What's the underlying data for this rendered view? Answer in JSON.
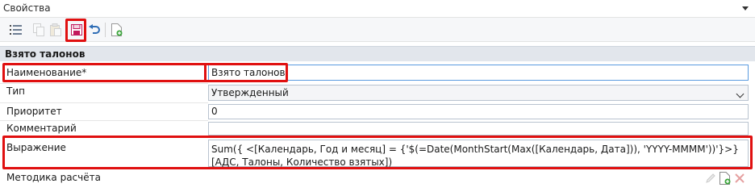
{
  "panel": {
    "title": "Свойства"
  },
  "toolbar": {
    "buttons": [
      {
        "name": "list-view",
        "icon": "list-icon",
        "enabled": true
      },
      {
        "name": "copy",
        "icon": "copy-icon",
        "enabled": false
      },
      {
        "name": "paste",
        "icon": "paste-icon",
        "enabled": false
      },
      {
        "name": "save",
        "icon": "save-icon",
        "enabled": true
      },
      {
        "name": "undo",
        "icon": "undo-icon",
        "enabled": true
      },
      {
        "name": "new-document",
        "icon": "new-document-icon",
        "enabled": true
      }
    ]
  },
  "section": {
    "title": "Взято талонов"
  },
  "fields": {
    "name": {
      "label": "Наименование*",
      "value": "Взято талонов"
    },
    "type": {
      "label": "Тип",
      "value": "Утвержденный"
    },
    "priority": {
      "label": "Приоритет",
      "value": "0"
    },
    "comment": {
      "label": "Комментарий",
      "value": ""
    },
    "expression": {
      "label": "Выражение",
      "value": "Sum({ <[Календарь, Год и месяц] = {'$(=Date(MonthStart(Max([Календарь, Дата])), 'YYYY-MMMM'))'}>} [АДС, Талоны, Количество взятых])"
    },
    "method": {
      "label": "Методика расчёта"
    }
  },
  "colors": {
    "highlight": "#e01010",
    "section_bg": "#e2e6ec",
    "field_border": "#b9c3cf",
    "focus_border": "#5a9be0",
    "save_icon": "#c2185b",
    "undo_icon": "#2f6db5"
  }
}
